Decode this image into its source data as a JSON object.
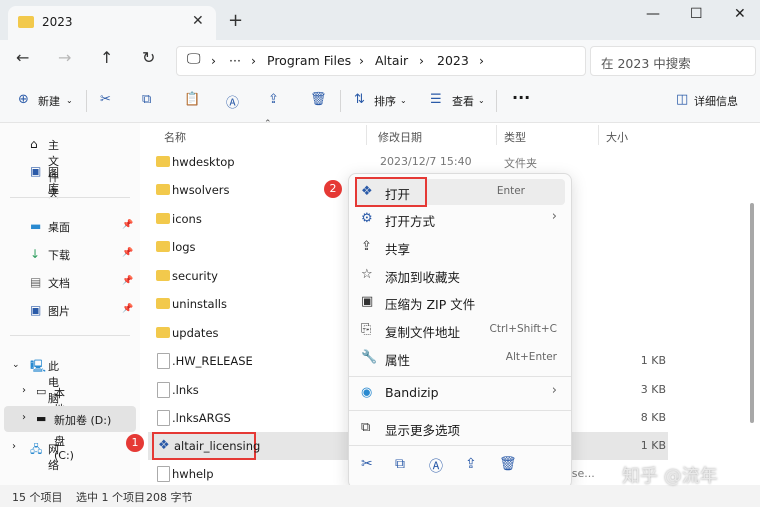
{
  "window": {
    "tab_title": "2023",
    "close_tab": "✕",
    "new_tab": "+",
    "minimize": "—",
    "maximize": "☐",
    "close": "✕"
  },
  "nav": {
    "back": "←",
    "forward": "→",
    "up": "↑",
    "refresh": "↻",
    "more": "···",
    "chevron": "›",
    "breadcrumb": [
      "Program Files",
      "Altair",
      "2023"
    ],
    "search_placeholder": "在 2023 中搜索"
  },
  "toolbar": {
    "new_label": "新建",
    "sort_label": "排序",
    "view_label": "查看",
    "more": "···",
    "details_label": "详细信息"
  },
  "sidebar": {
    "items": [
      {
        "icon": "home-icon",
        "label": "主文件夹"
      },
      {
        "icon": "gallery-icon",
        "label": "图库"
      },
      {
        "icon": "desktop-icon",
        "label": "桌面"
      },
      {
        "icon": "download-icon",
        "label": "下载"
      },
      {
        "icon": "documents-icon",
        "label": "文档"
      },
      {
        "icon": "pictures-icon",
        "label": "图片"
      },
      {
        "icon": "this-pc-icon",
        "label": "此电脑"
      },
      {
        "icon": "drive-icon",
        "label": "本地磁盘 (C:)"
      },
      {
        "icon": "drive-icon",
        "label": "新加卷 (D:)"
      },
      {
        "icon": "network-icon",
        "label": "网络"
      }
    ]
  },
  "columns": {
    "name": "名称",
    "modified": "修改日期",
    "type": "类型",
    "size": "大小"
  },
  "files": [
    {
      "name": "hwdesktop",
      "kind": "folder",
      "modified": "2023/12/7 15:40",
      "type": "文件夹",
      "size": ""
    },
    {
      "name": "hwsolvers",
      "kind": "folder",
      "modified": "",
      "type": "",
      "size": ""
    },
    {
      "name": "icons",
      "kind": "folder",
      "modified": "",
      "type": "",
      "size": ""
    },
    {
      "name": "logs",
      "kind": "folder",
      "modified": "",
      "type": "",
      "size": ""
    },
    {
      "name": "security",
      "kind": "folder",
      "modified": "",
      "type": "",
      "size": ""
    },
    {
      "name": "uninstalls",
      "kind": "folder",
      "modified": "",
      "type": "",
      "size": ""
    },
    {
      "name": "updates",
      "kind": "folder",
      "modified": "",
      "type": "",
      "size": ""
    },
    {
      "name": ".HW_RELEASE",
      "kind": "file",
      "modified": "",
      "type": "",
      "size": "1 KB"
    },
    {
      "name": ".lnks",
      "kind": "file",
      "modified": "",
      "type": "",
      "size": "3 KB"
    },
    {
      "name": ".lnksARGS",
      "kind": "file",
      "modified": "",
      "type": "",
      "size": "8 KB"
    },
    {
      "name": "altair_licensing",
      "kind": "app",
      "modified": "",
      "type": "",
      "size": "1 KB"
    },
    {
      "name": "hwhelp",
      "kind": "file",
      "modified": "",
      "type": "sse...",
      "size": ""
    }
  ],
  "context_menu": {
    "items": [
      {
        "label": "打开",
        "shortcut": "Enter"
      },
      {
        "label": "打开方式",
        "shortcut": "›"
      },
      {
        "label": "共享",
        "shortcut": ""
      },
      {
        "label": "添加到收藏夹",
        "shortcut": ""
      },
      {
        "label": "压缩为 ZIP 文件",
        "shortcut": ""
      },
      {
        "label": "复制文件地址",
        "shortcut": "Ctrl+Shift+C"
      },
      {
        "label": "属性",
        "shortcut": "Alt+Enter"
      },
      {
        "label": "Bandizip",
        "shortcut": "›"
      },
      {
        "label": "显示更多选项",
        "shortcut": ""
      }
    ]
  },
  "badges": {
    "one": "1",
    "two": "2"
  },
  "status": {
    "count": "15 个项目",
    "selected": "选中 1 个项目",
    "size": "208 字节"
  },
  "watermark": "知乎 @流年",
  "colors": {
    "accent": "#2a5aa8",
    "highlight": "#e53935",
    "folder": "#f2c94c"
  }
}
